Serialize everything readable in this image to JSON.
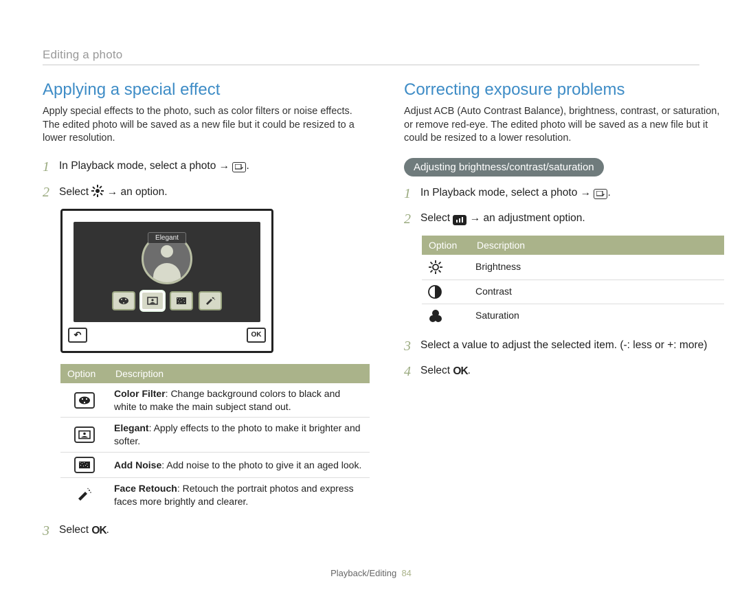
{
  "header": {
    "section": "Editing a photo"
  },
  "left": {
    "title": "Applying a special effect",
    "intro": "Apply special effects to the photo, such as color filters or noise effects. The edited photo will be saved as a new file but it could be resized to a lower resolution.",
    "step1_a": "In Playback mode, select a photo ",
    "step1_c": ".",
    "step2_a": "Select ",
    "step2_c": " → an option.",
    "screen_label": "Elegant",
    "screen_ok": "OK",
    "table": {
      "h1": "Option",
      "h2": "Description",
      "r1b": "Color Filter",
      "r1t": ": Change background colors to black and white to make the main subject stand out.",
      "r2b": "Elegant",
      "r2t": ": Apply effects to the photo to make it brighter and softer.",
      "r3b": "Add Noise",
      "r3t": ": Add noise to the photo to give it an aged look.",
      "r4b": "Face Retouch",
      "r4t": ": Retouch the portrait photos and express faces more brightly and clearer."
    },
    "step3_a": "Select ",
    "step3_ok": "OK",
    "step3_c": "."
  },
  "right": {
    "title": "Correcting exposure problems",
    "intro": "Adjust ACB (Auto Contrast Balance), brightness, contrast, or saturation, or remove red-eye. The edited photo will be saved as a new file but it could be resized to a lower resolution.",
    "pill": "Adjusting brightness/contrast/saturation",
    "step1_a": "In Playback mode, select a photo ",
    "step1_c": ".",
    "step2_a": "Select ",
    "step2_c": " → an adjustment option.",
    "table": {
      "h1": "Option",
      "h2": "Description",
      "r1": "Brightness",
      "r2": "Contrast",
      "r3": "Saturation"
    },
    "step3": "Select a value to adjust the selected item. (-: less or +: more)",
    "step4_a": "Select ",
    "step4_ok": "OK",
    "step4_c": "."
  },
  "footer": {
    "section": "Playback/Editing",
    "page": "84"
  }
}
